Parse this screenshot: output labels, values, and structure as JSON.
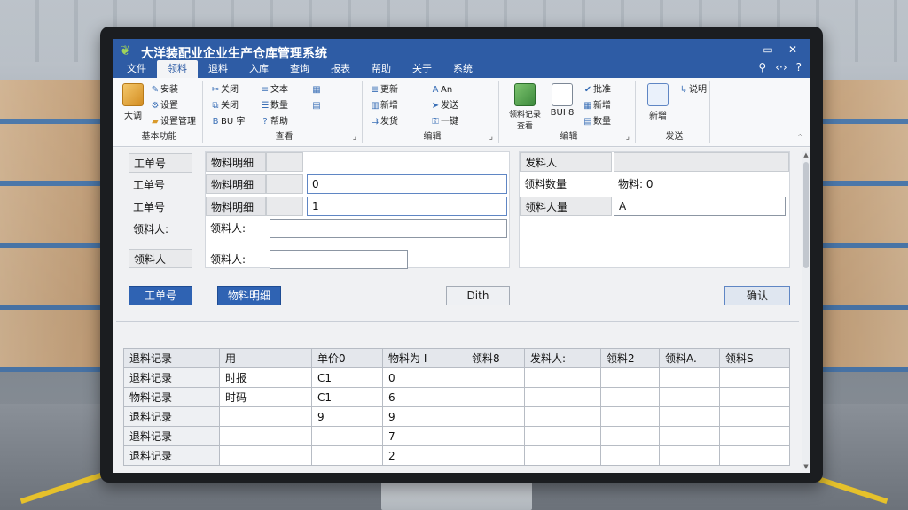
{
  "window": {
    "title": "大洋装配业企业生产仓库管理系统",
    "controls": [
      "–",
      "▭",
      "✕"
    ]
  },
  "menu": {
    "items": [
      "文件",
      "领料",
      "退料",
      "入库",
      "查询",
      "报表",
      "帮助",
      "关于",
      "系统"
    ],
    "active_index": 1,
    "right_icons": [
      "user-icon",
      "settings-icon"
    ]
  },
  "ribbon": {
    "groups": [
      {
        "title": "基本功能",
        "big": {
          "label": "大调"
        },
        "small": [
          "安装",
          "设置",
          "设置管理"
        ]
      },
      {
        "title": "查看",
        "small": [
          "关闭",
          "关闭",
          "BU 字",
          "文本",
          "数量",
          "帮助"
        ]
      },
      {
        "title": "编辑",
        "small": [
          "更新",
          "新增",
          "发货",
          "An",
          "发送",
          "一键"
        ]
      },
      {
        "title": "编辑",
        "big": [
          {
            "label": "领料记录\n查看"
          },
          {
            "label": "BUI 8"
          }
        ],
        "small": [
          "批准",
          "新增",
          "数量"
        ]
      },
      {
        "title": "发送",
        "big": {
          "label": "新增"
        },
        "small": [
          "说明"
        ]
      }
    ]
  },
  "form": {
    "left_labels": [
      "工单号",
      "工单号",
      "工单号",
      "领料人:",
      "领料人"
    ],
    "field_labels": [
      "物料明细",
      "物料明细",
      "物料明细",
      "领料人:",
      "领料人:"
    ],
    "field_values": [
      "",
      "0",
      "1",
      "",
      ""
    ],
    "right_labels": [
      "发料人",
      "领料数量",
      "领料人量"
    ],
    "right_values": [
      "",
      "物料: 0",
      "A"
    ]
  },
  "buttons": {
    "work_order": "工单号",
    "material_detail": "物料明细",
    "dith": "Dith",
    "ok": "确认"
  },
  "grid": {
    "columns": [
      "退料记录",
      "用",
      "单价0",
      "物料为 I",
      "领料8",
      "发料人:",
      "领料2",
      "领料A.",
      "领料S"
    ],
    "rows": [
      [
        "退料记录",
        "时报",
        "C1",
        "0",
        "",
        "",
        "",
        "",
        ""
      ],
      [
        "物料记录",
        "时码",
        "C1",
        "6",
        "",
        "",
        "",
        "",
        ""
      ],
      [
        "退料记录",
        "",
        "9",
        "9",
        "",
        "",
        "",
        "",
        ""
      ],
      [
        "退料记录",
        "",
        "",
        "7",
        "",
        "",
        "",
        "",
        ""
      ],
      [
        "退料记录",
        "",
        "",
        "2",
        "",
        "",
        "",
        "",
        ""
      ]
    ]
  }
}
